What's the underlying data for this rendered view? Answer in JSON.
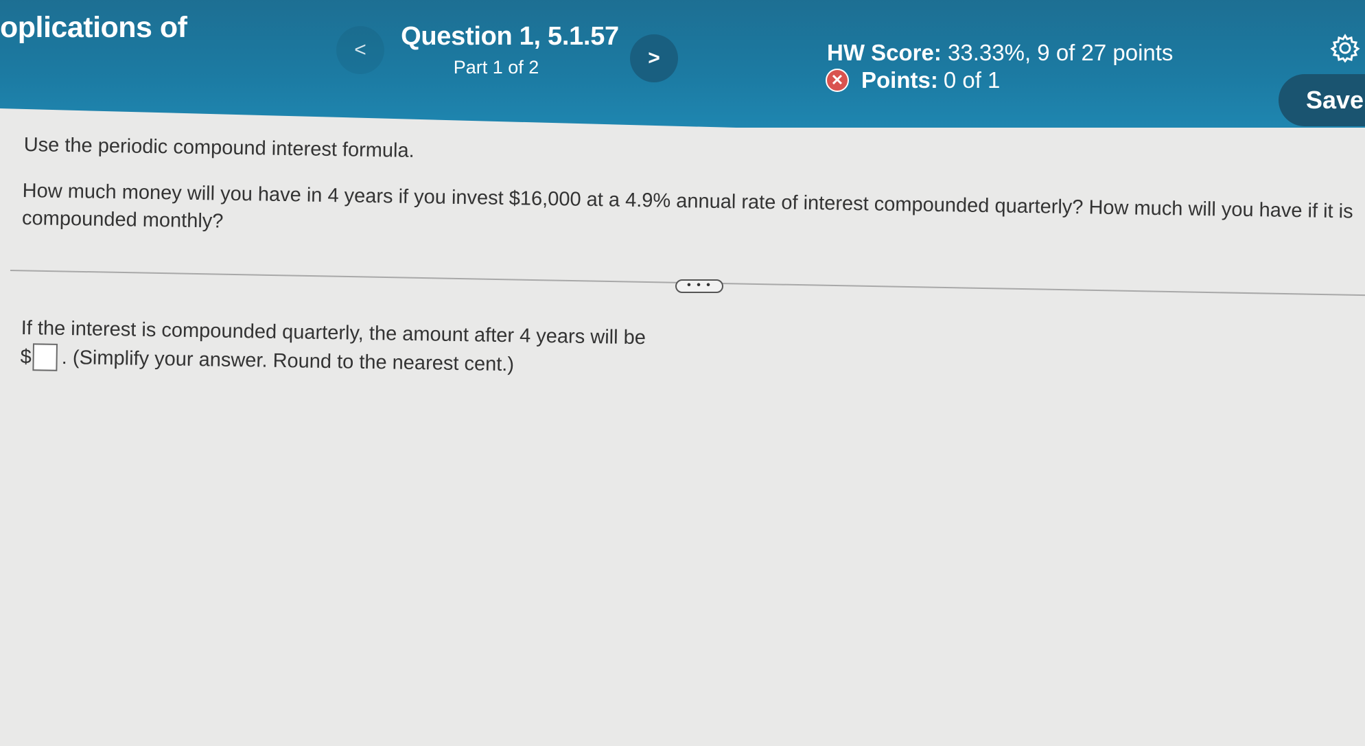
{
  "header": {
    "course_title": "oplications of",
    "prev_label": "<",
    "question_title": "Question 1, 5.1.57",
    "question_part": "Part 1 of 2",
    "next_label": ">",
    "hw_score_label": "HW Score:",
    "hw_score_value": "33.33%, 9 of 27 points",
    "points_label": "Points:",
    "points_value": "0 of 1",
    "save_label": "Save",
    "icons": {
      "points_status": "x-circle-icon",
      "settings": "gear-icon"
    },
    "colors": {
      "header_bg": "#1c7ba3",
      "save_bg": "#1a5470",
      "incorrect": "#d9534f"
    }
  },
  "problem": {
    "instruction": "Use the periodic compound interest formula.",
    "question": "How much money will you have in 4 years if you invest $16,000 at a 4.9% annual rate of interest compounded quarterly?  How much will you have if it is compounded monthly?",
    "more_label": "• • •"
  },
  "answer": {
    "prompt": "If the interest is compounded quarterly, the amount after 4 years will be",
    "currency": "$",
    "input_value": "",
    "hint": ". (Simplify your answer. Round to the nearest cent.)"
  }
}
